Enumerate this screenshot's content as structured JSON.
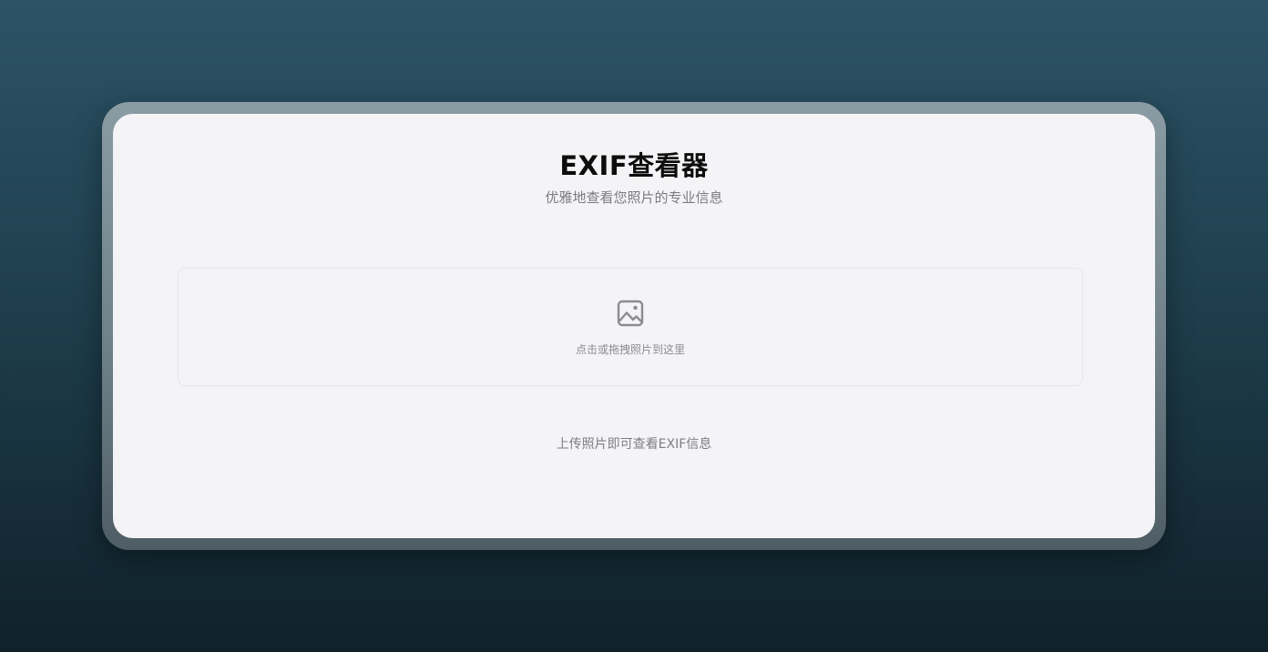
{
  "app": {
    "title": "EXIF查看器",
    "subtitle": "优雅地查看您照片的专业信息"
  },
  "upload": {
    "icon": "image-icon",
    "prompt": "点击或拖拽照片到这里"
  },
  "status": {
    "hint": "上传照片即可查看EXIF信息"
  },
  "colors": {
    "background_top": "#2c5466",
    "background_bottom": "#10212a",
    "card": "#f4f4f7",
    "icon": "#8c8c90"
  }
}
